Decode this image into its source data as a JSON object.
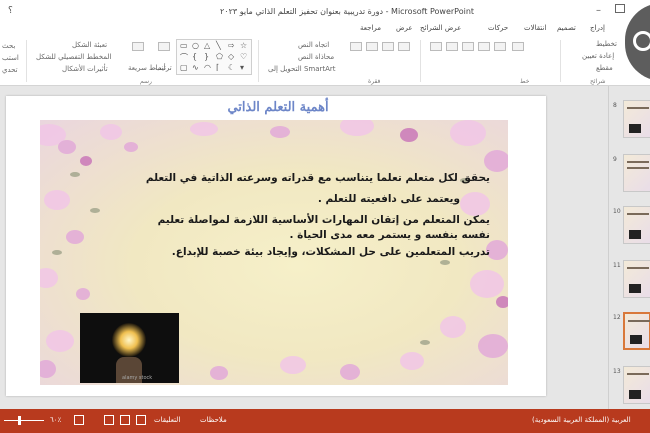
{
  "window": {
    "title": "دورة تدريبية بعنوان تحفيز التعلم الذاتي  مايو ٢٠٢٣ - Microsoft PowerPoint",
    "help": "؟",
    "minimize": "–"
  },
  "tabs": [
    {
      "label": "إدراج"
    },
    {
      "label": "تصميم"
    },
    {
      "label": "انتقالات"
    },
    {
      "label": "حركات"
    },
    {
      "label": "عرض الشرائح"
    },
    {
      "label": "مراجعة"
    },
    {
      "label": "عرض"
    }
  ],
  "ribbon": {
    "left_col": [
      "بحث",
      "استب",
      "تحدي"
    ],
    "shape_fill": "تعبئة الشكل",
    "shape_outline": "المخطط التفصيلي للشكل",
    "shape_effects": "تأثيرات الأشكال",
    "quick_styles": "أنماط سريعة",
    "arrange": "ترتيب",
    "text_direction": "اتجاه النص",
    "align_text": "محاذاة النص",
    "convert_smartart": "التحويل إلى SmartArt",
    "group_drawing": "رسم",
    "group_paragraph": "فقرة",
    "group_font": "خط",
    "group_slides": "شرائح",
    "layout": "تخطيط",
    "reset": "إعادة تعيين",
    "section": "مقطع",
    "new_slide": "شريحة جديدة"
  },
  "slide": {
    "title": "أهمية التعلم الذاتي",
    "lines": [
      "يحقق لكل متعلم تعلما يتناسب مع قدراته وسرعته الذاتية في التعلم",
      "ويعتمد على دافعيته للتعلم .",
      "يمكن المتعلم من إتقان المهارات الأساسية اللازمة لمواصلة تعليم",
      "نفسه بنفسه و يستمر معه مدى الحياة .",
      "تدريب المتعلمين على حل المشكلات، وإيجاد بيئة خصبة للإبداع."
    ],
    "photo_watermark": "alamy stock"
  },
  "thumbnails": [
    {
      "num": "8"
    },
    {
      "num": "9"
    },
    {
      "num": "10"
    },
    {
      "num": "11"
    },
    {
      "num": "12"
    },
    {
      "num": "13"
    }
  ],
  "status": {
    "language": "العربية (المملكة العربية السعودية)",
    "comments": "التعليقات",
    "notes": "ملاحظات",
    "zoom": "٦٠٪"
  },
  "colors": {
    "accent": "#c43e1c",
    "status_bar": "#b83a1e",
    "title_blue": "#6d86c8"
  }
}
